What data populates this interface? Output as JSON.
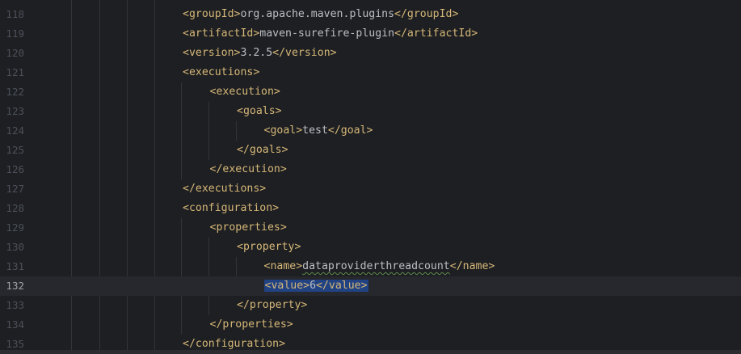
{
  "editor": {
    "lines": [
      {
        "num": "118",
        "indent": 0,
        "segments": [
          {
            "t": "tag",
            "v": "<groupId>"
          },
          {
            "t": "txt",
            "v": "org.apache.maven.plugins"
          },
          {
            "t": "tag",
            "v": "</groupId>"
          }
        ]
      },
      {
        "num": "119",
        "indent": 0,
        "segments": [
          {
            "t": "tag",
            "v": "<artifactId>"
          },
          {
            "t": "txt",
            "v": "maven-surefire-plugin"
          },
          {
            "t": "tag",
            "v": "</artifactId>"
          }
        ]
      },
      {
        "num": "120",
        "indent": 0,
        "segments": [
          {
            "t": "tag",
            "v": "<version>"
          },
          {
            "t": "txt",
            "v": "3.2.5"
          },
          {
            "t": "tag",
            "v": "</version>"
          }
        ]
      },
      {
        "num": "121",
        "indent": 0,
        "segments": [
          {
            "t": "tag",
            "v": "<executions>"
          }
        ]
      },
      {
        "num": "122",
        "indent": 1,
        "segments": [
          {
            "t": "tag",
            "v": "<execution>"
          }
        ]
      },
      {
        "num": "123",
        "indent": 2,
        "segments": [
          {
            "t": "tag",
            "v": "<goals>"
          }
        ]
      },
      {
        "num": "124",
        "indent": 3,
        "segments": [
          {
            "t": "tag",
            "v": "<goal>"
          },
          {
            "t": "txt",
            "v": "test"
          },
          {
            "t": "tag",
            "v": "</goal>"
          }
        ]
      },
      {
        "num": "125",
        "indent": 2,
        "segments": [
          {
            "t": "tag",
            "v": "</goals>"
          }
        ]
      },
      {
        "num": "126",
        "indent": 1,
        "segments": [
          {
            "t": "tag",
            "v": "</execution>"
          }
        ]
      },
      {
        "num": "127",
        "indent": 0,
        "segments": [
          {
            "t": "tag",
            "v": "</executions>"
          }
        ]
      },
      {
        "num": "128",
        "indent": 0,
        "segments": [
          {
            "t": "tag",
            "v": "<configuration>"
          }
        ]
      },
      {
        "num": "129",
        "indent": 1,
        "segments": [
          {
            "t": "tag",
            "v": "<properties>"
          }
        ]
      },
      {
        "num": "130",
        "indent": 2,
        "segments": [
          {
            "t": "tag",
            "v": "<property>"
          }
        ]
      },
      {
        "num": "131",
        "indent": 3,
        "segments": [
          {
            "t": "tag",
            "v": "<name>"
          },
          {
            "t": "typo",
            "v": "dataproviderthreadcount"
          },
          {
            "t": "tag",
            "v": "</name>"
          }
        ]
      },
      {
        "num": "132",
        "indent": 3,
        "current": true,
        "segments": [
          {
            "t": "tag",
            "v": "<value>",
            "sel": true
          },
          {
            "t": "txt",
            "v": "6",
            "sel": true
          },
          {
            "t": "tag",
            "v": "</value>",
            "sel": true
          }
        ]
      },
      {
        "num": "133",
        "indent": 2,
        "segments": [
          {
            "t": "tag",
            "v": "</property>"
          }
        ]
      },
      {
        "num": "134",
        "indent": 1,
        "segments": [
          {
            "t": "tag",
            "v": "</properties>"
          }
        ]
      },
      {
        "num": "135",
        "indent": 0,
        "segments": [
          {
            "t": "tag",
            "v": "</configuration>"
          }
        ]
      }
    ]
  },
  "colors": {
    "background": "#1e1f22",
    "tag": "#d5b778",
    "text": "#bcbec4",
    "line_number": "#4b5059",
    "selection": "#214283",
    "current_line": "#26282e"
  }
}
